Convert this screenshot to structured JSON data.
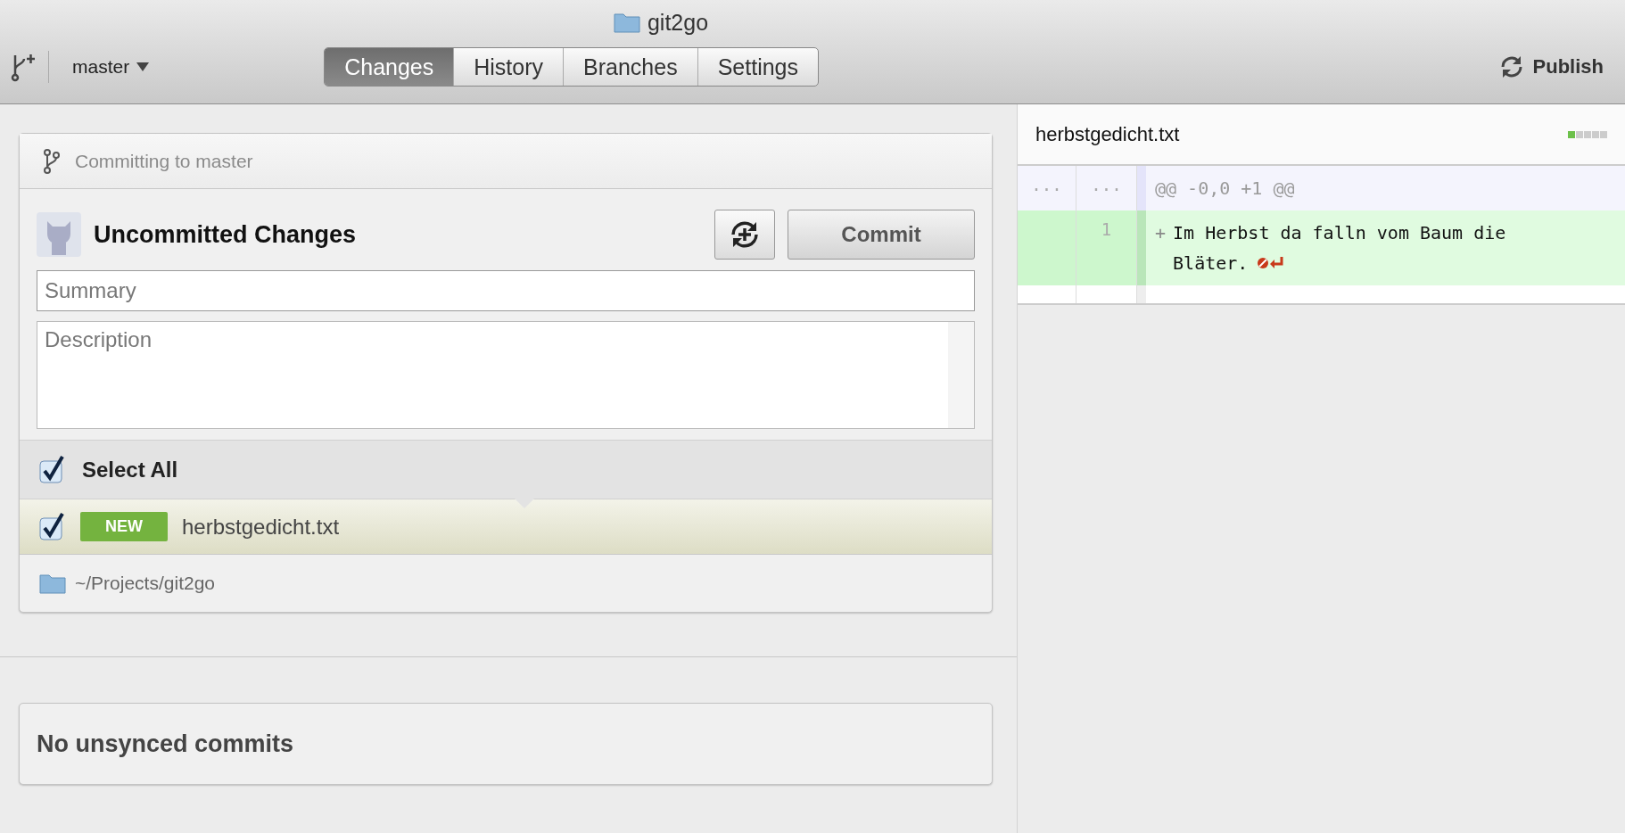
{
  "window": {
    "title": "git2go"
  },
  "toolbar": {
    "branch": "master",
    "tabs": [
      {
        "label": "Changes",
        "selected": true
      },
      {
        "label": "History",
        "selected": false
      },
      {
        "label": "Branches",
        "selected": false
      },
      {
        "label": "Settings",
        "selected": false
      }
    ],
    "publish": "Publish"
  },
  "commit_panel": {
    "header": "Committing to master",
    "title": "Uncommitted Changes",
    "commit_button": "Commit",
    "summary": {
      "placeholder": "Summary"
    },
    "description": {
      "placeholder": "Description"
    },
    "select_all": {
      "label": "Select All",
      "checked": true
    },
    "files": [
      {
        "name": "herbstgedicht.txt",
        "badge": "NEW",
        "checked": true,
        "selected": true
      }
    ],
    "path": "~/Projects/git2go"
  },
  "sync_panel": {
    "text": "No unsynced commits"
  },
  "diff": {
    "file": "herbstgedicht.txt",
    "stat": [
      {
        "color": "#6cc04a"
      },
      {
        "color": "#cccccc"
      },
      {
        "color": "#cccccc"
      },
      {
        "color": "#cccccc"
      },
      {
        "color": "#cccccc"
      }
    ],
    "lines": [
      {
        "kind": "hunk",
        "old": "...",
        "new": "...",
        "text": "@@ -0,0 +1 @@"
      },
      {
        "kind": "added",
        "new": "1",
        "marker": "+",
        "text": "Im Herbst da falln vom Baum die Bläter.",
        "no_newline": true
      }
    ]
  }
}
